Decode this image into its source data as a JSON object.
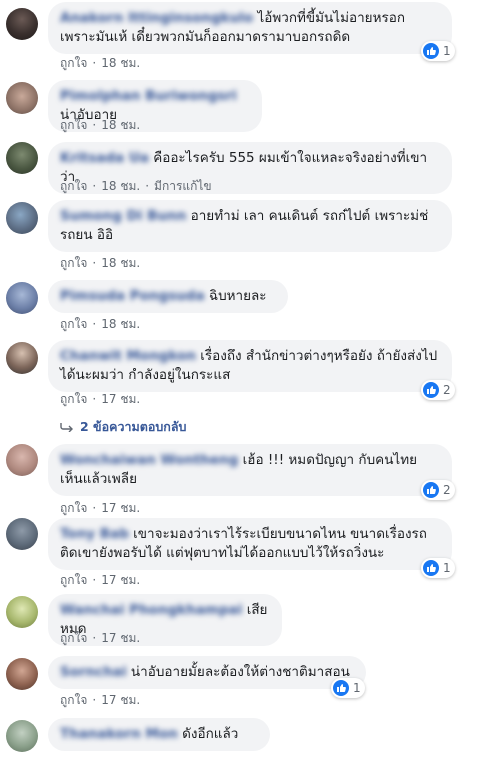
{
  "icons": {
    "like": "thumbs-up-icon",
    "reply": "reply-arrow-icon"
  },
  "colors": {
    "link": "#385898",
    "bubble": "#f2f3f5",
    "like_badge": "#1877f2"
  },
  "like_label": "ถูกใจ",
  "comments": [
    {
      "name": "Anakorn Ittinginsongkulo",
      "text": "ไอ้พวกที่ขี้มันไม่อายหรอกเพราะมันเห้ เดี๋ยวพวกมันก็ออกมาดรามาบอกรถดิด",
      "time": "18 ชม.",
      "reactions": "1"
    },
    {
      "name": "Pimolphan Buriwongsri",
      "text": "น่าอับอาย",
      "time": "18 ชม."
    },
    {
      "name": "Kritsada Ua",
      "text": "คืออะไรครับ 555 ผมเข้าใจแหละจริงอย่างที่เขาว่า",
      "time": "18 ชม.",
      "edited": "มีการแก้ไข"
    },
    {
      "name": "Sumong Di Bunn",
      "text": "อายทำม่ เลา คนเดินต์ รถก๋ไปต์ เพราะม่ช่ รถยน อิอิ",
      "time": "18 ชม."
    },
    {
      "name": "Pimsuda Pongsuda",
      "text": "ฉิบหายละ",
      "time": "18 ชม."
    },
    {
      "name": "Chanwit Mongkon",
      "text": "เรื่องถึง สำนักข่าวต่างๆหรือยัง ถ้ายังส่งไปได้นะผมว่า กำลังอยู่ในกระแส",
      "time": "17 ชม.",
      "reactions": "2",
      "replies": "2 ข้อความตอบกลับ"
    },
    {
      "name": "Wonchaiwan Wontheng",
      "text": "เฮ้อ !!! หมดปัญญา กับคนไทย เห็นแล้วเพลีย",
      "time": "17 ชม.",
      "reactions": "2"
    },
    {
      "name": "Tony Bab",
      "text": "เขาจะมองว่าเราไร้ระเบียบขนาดไหน ขนาดเรื่องรถติดเขายังพอรับได้ แต่ฟุตบาทไม่ได้ออกแบบไว้ให้รถวิ่งนะ",
      "time": "17 ชม.",
      "reactions": "1"
    },
    {
      "name": "Wanchai Phongkhampai",
      "text": "เสียหมด",
      "time": "17 ชม."
    },
    {
      "name": "Sornchai",
      "text": "น่าอับอายมั้ยละต้องให้ต่างชาติมาสอน",
      "time": "17 ชม.",
      "reactions": "1"
    },
    {
      "name": "Thanakorn Mon",
      "text": "ดังอีกแล้ว",
      "time": ""
    }
  ]
}
